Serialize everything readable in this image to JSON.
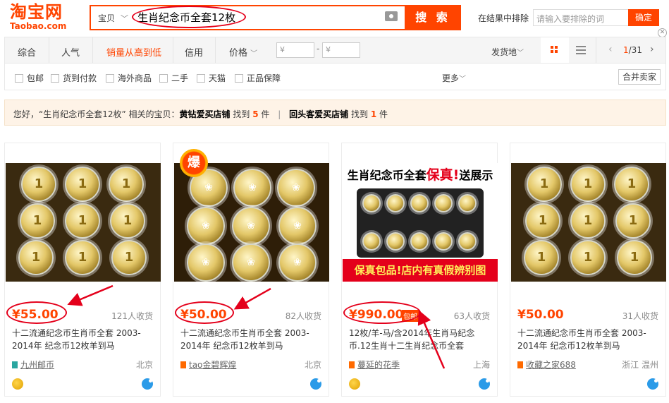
{
  "header": {
    "logo_cn": "淘宝网",
    "logo_en": "Taobao.com",
    "search_category": "宝贝",
    "search_query": "生肖纪念币全套12枚",
    "search_button": "搜 索",
    "exclude_label": "在结果中排除",
    "exclude_placeholder": "请输入要排除的词",
    "confirm_button": "确定"
  },
  "sortbar": {
    "tabs": [
      "综合",
      "人气",
      "销量从高到低",
      "信用",
      "价格"
    ],
    "price_min_placeholder": "¥",
    "price_max_placeholder": "¥",
    "price_dash": "-",
    "ship_from": "发货地",
    "page_current": "1",
    "page_total": "/31"
  },
  "filters": {
    "options": [
      "包邮",
      "货到付款",
      "海外商品",
      "二手",
      "天猫",
      "正品保障"
    ],
    "more": "更多",
    "merge_sellers": "合并卖家"
  },
  "notice": {
    "prefix": "您好，“生肖纪念币全套12枚” 相关的宝贝：",
    "shop1": "黄钻爱买店铺",
    "found": "找到",
    "count1": "5",
    "unit": "件",
    "divider": "|",
    "shop2": "回头客爱买店铺",
    "count2": "1"
  },
  "products": [
    {
      "price": "¥55.00",
      "sold": "121人收货",
      "title": "十二流通纪念币生肖币全套 2003-2014年 纪念币12枚羊到马",
      "shop": "九州邮币",
      "location": "北京"
    },
    {
      "price": "¥50.00",
      "sold": "82人收货",
      "title": "十二流通纪念币生肖币全套 2003-2014年 纪念币12枚羊到马",
      "shop": "tao金碧辉煌",
      "location": "北京"
    },
    {
      "price": "¥990.00",
      "badge": "包邮",
      "sold": "63人收货",
      "title": "12枚/羊-马/含2014年生肖马纪念币.12生肖十二生肖纪念币全套",
      "shop": "蔓延的花季",
      "location": "上海",
      "banner_top_a": "生肖纪念币全套",
      "banner_top_b": "保真!",
      "banner_top_c": "送展示盒",
      "banner_bottom": "保真包品!店内有真假辨别图"
    },
    {
      "price": "¥50.00",
      "sold": "31人收货",
      "title": "十二流通纪念币生肖币全套 2003-2014年 纪念币12枚羊到马",
      "shop": "收藏之家688",
      "location": "浙江 温州"
    }
  ],
  "colors": {
    "accent": "#ff4400",
    "annotation": "#e4001b"
  }
}
